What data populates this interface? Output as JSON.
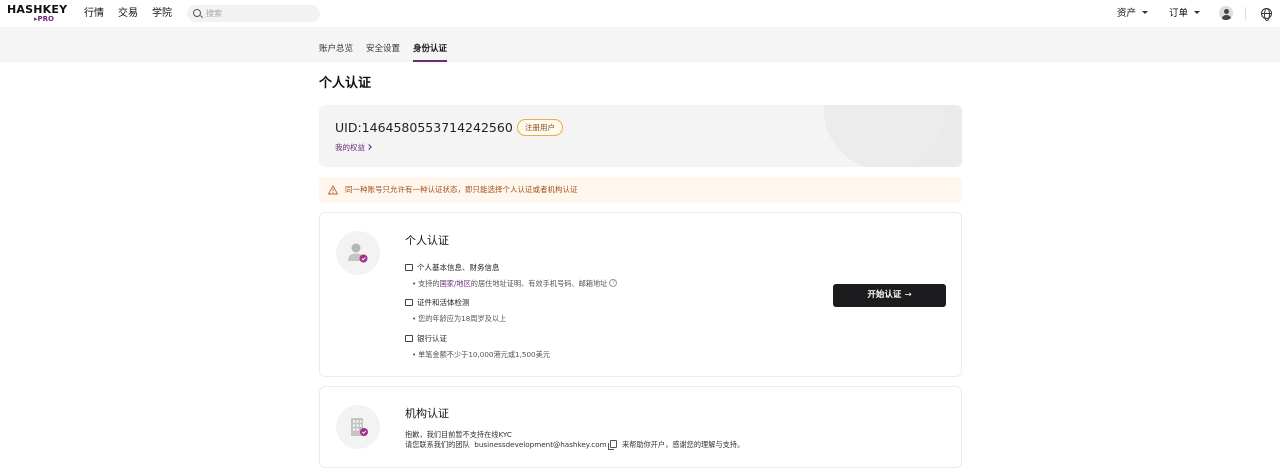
{
  "nav": {
    "logo_main": "HASHKEY",
    "logo_sub": "PRO",
    "links": [
      "行情",
      "交易",
      "学院"
    ],
    "search_placeholder": "搜索",
    "assets_label": "资产",
    "orders_label": "订单"
  },
  "subnav": {
    "tabs": [
      "账户总览",
      "安全设置",
      "身份认证"
    ],
    "active_index": 2
  },
  "page": {
    "title": "个人认证"
  },
  "uid_card": {
    "uid": "UID:1464580553714242560",
    "badge": "注册用户",
    "rights_link": "我的权益"
  },
  "warning": {
    "text": "同一种账号只允许有一种认证状态，即只能选择个人认证或者机构认证"
  },
  "personal": {
    "title": "个人认证",
    "sections": [
      {
        "label": "个人基本信息、财务信息"
      },
      {
        "label": "证件和活体检测",
        "bullet": "您的年龄应为18周岁及以上"
      },
      {
        "label": "银行认证",
        "bullet": "单笔金额不少于10,000港元或1,500美元"
      }
    ],
    "bullet1_prefix": "支持的",
    "bullet1_highlight": "国家/地区",
    "bullet1_suffix": "的居住地址证明、有效手机号码、邮箱地址",
    "help_mark": "?",
    "start_button": "开始认证",
    "start_arrow": "→"
  },
  "org": {
    "title": "机构认证",
    "line1": "抱歉，我们目前暂不支持在线KYC",
    "line2_prefix": "请您联系我们的团队",
    "email": "businessdevelopment@hashkey.com",
    "line2_suffix": "来帮助你开户，感谢您的理解与支持。"
  },
  "colors": {
    "accent": "#6a2a7a",
    "warning_text": "#a3501a",
    "button": "#1c1c1e"
  }
}
